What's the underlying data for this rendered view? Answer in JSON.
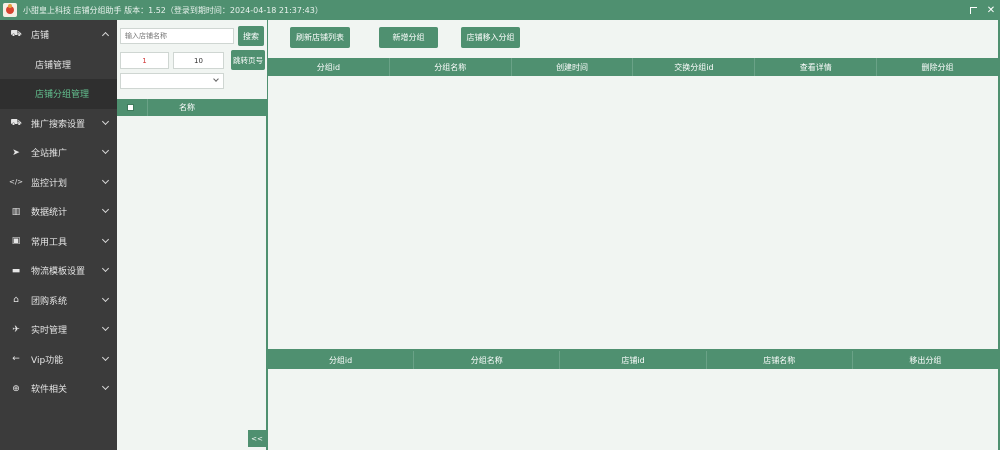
{
  "titlebar": {
    "title": "小甜皇上科技 店铺分组助手 版本：1.52（登录到期时间：2024-04-18 21:37:43）"
  },
  "sidebar": {
    "items": [
      {
        "label": "店铺",
        "icon": "car-icon",
        "glyph": "⛟",
        "expanded": true
      },
      {
        "label": "店铺管理",
        "icon": "tag-icon",
        "sub": true
      },
      {
        "label": "店铺分组管理",
        "icon": "tag-icon",
        "sub": true,
        "active": true
      },
      {
        "label": "推广搜索设置",
        "icon": "car-icon",
        "glyph": "⛟"
      },
      {
        "label": "全站推广",
        "icon": "send-icon",
        "glyph": "➤"
      },
      {
        "label": "监控计划",
        "icon": "code-icon",
        "glyph": "</>"
      },
      {
        "label": "数据统计",
        "icon": "bar-chart-icon",
        "glyph": "▥"
      },
      {
        "label": "常用工具",
        "icon": "contact-icon",
        "glyph": "▣"
      },
      {
        "label": "物流模板设置",
        "icon": "briefcase-icon",
        "glyph": "▬"
      },
      {
        "label": "团购系统",
        "icon": "bank-icon",
        "glyph": "⌂"
      },
      {
        "label": "实时管理",
        "icon": "plane-icon",
        "glyph": "✈"
      },
      {
        "label": "Vip功能",
        "icon": "arrow-left-icon",
        "glyph": "←"
      },
      {
        "label": "软件相关",
        "icon": "download-circle-icon",
        "glyph": "⊕"
      }
    ]
  },
  "leftpanel": {
    "search_placeholder": "输入店铺名称",
    "search_button": "搜索",
    "page_from": "1",
    "page_to": "10",
    "jump_button": "跳转页号",
    "select_value": "",
    "list_header": "名称",
    "collapse_label": "<<"
  },
  "main": {
    "toolbar": {
      "refresh_label": "刷新店铺列表",
      "add_group_label": "新增分组",
      "batch_add_label": "店铺移入分组"
    },
    "group_columns": [
      "分组id",
      "分组名称",
      "创建时间",
      "交换分组id",
      "查看详情",
      "删除分组"
    ],
    "shop_columns": [
      "分组id",
      "分组名称",
      "店铺id",
      "店铺名称",
      "移出分组"
    ]
  },
  "colors": {
    "accent": "#4f9070",
    "sidebar_bg": "#3b3b3b",
    "active_text": "#63c08f",
    "panel_bg": "#f1f5f2"
  }
}
